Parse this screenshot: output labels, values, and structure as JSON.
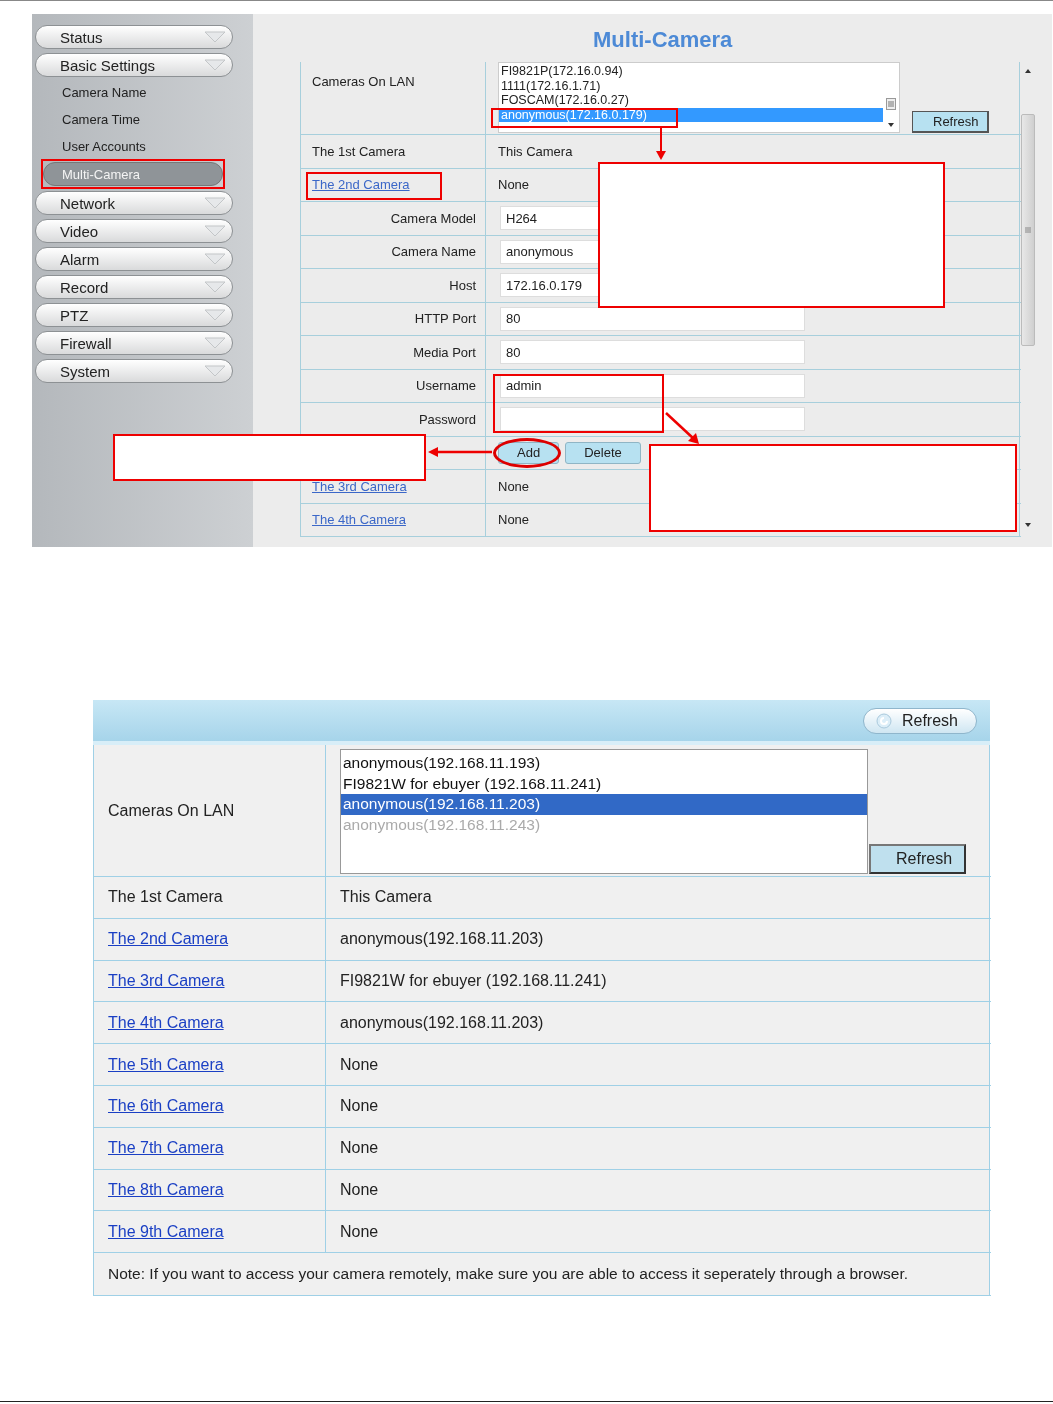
{
  "top_screenshot": {
    "sidebar": {
      "items": [
        {
          "kind": "menu",
          "label": "Status",
          "selected": false
        },
        {
          "kind": "menu",
          "label": "Basic Settings",
          "selected": false
        },
        {
          "kind": "submenu",
          "label": "Camera Name",
          "selected": false
        },
        {
          "kind": "submenu",
          "label": "Camera Time",
          "selected": false
        },
        {
          "kind": "submenu",
          "label": "User Accounts",
          "selected": false
        },
        {
          "kind": "submenu",
          "label": "Multi-Camera",
          "selected": true
        },
        {
          "kind": "menu",
          "label": "Network",
          "selected": false
        },
        {
          "kind": "menu",
          "label": "Video",
          "selected": false
        },
        {
          "kind": "menu",
          "label": "Alarm",
          "selected": false
        },
        {
          "kind": "menu",
          "label": "Record",
          "selected": false
        },
        {
          "kind": "menu",
          "label": "PTZ",
          "selected": false
        },
        {
          "kind": "menu",
          "label": "Firewall",
          "selected": false
        },
        {
          "kind": "menu",
          "label": "System",
          "selected": false
        }
      ]
    },
    "title": "Multi-Camera",
    "cameras_on_lan": {
      "label": "Cameras On LAN",
      "options": [
        {
          "label": "FI9821P(172.16.0.94)",
          "selected": false
        },
        {
          "label": "1111(172.16.1.71)",
          "selected": false
        },
        {
          "label": "FOSCAM(172.16.0.27)",
          "selected": false
        },
        {
          "label": "anonymous(172.16.0.179)",
          "selected": true
        }
      ],
      "button": "Refresh"
    },
    "rows": [
      {
        "kind": "text",
        "label": "The 1st Camera",
        "value": "This Camera"
      },
      {
        "kind": "link",
        "label": "The 2nd Camera",
        "value": "None"
      },
      {
        "kind": "field",
        "label": "Camera Model",
        "value": "H264"
      },
      {
        "kind": "field",
        "label": "Camera Name",
        "value": "anonymous"
      },
      {
        "kind": "field",
        "label": "Host",
        "value": "172.16.0.179"
      },
      {
        "kind": "field",
        "label": "HTTP Port",
        "value": "80"
      },
      {
        "kind": "field",
        "label": "Media Port",
        "value": "80"
      },
      {
        "kind": "field",
        "label": "Username",
        "value": "admin"
      },
      {
        "kind": "field",
        "label": "Password"
      },
      {
        "kind": "buttons",
        "buttons": [
          "Add",
          "Delete"
        ]
      },
      {
        "kind": "link",
        "label": "The 3rd Camera",
        "value": "None"
      },
      {
        "kind": "link",
        "label": "The 4th Camera",
        "value": "None"
      }
    ]
  },
  "bottom_screenshot": {
    "header_button": "Refresh",
    "cameras_on_lan": {
      "label": "Cameras On LAN",
      "options": [
        {
          "label": "anonymous(192.168.11.193)",
          "selected": false,
          "disabled": false
        },
        {
          "label": "FI9821W for ebuyer (192.168.11.241)",
          "selected": false,
          "disabled": false
        },
        {
          "label": "anonymous(192.168.11.203)",
          "selected": true,
          "disabled": false
        },
        {
          "label": "anonymous(192.168.11.243)",
          "selected": false,
          "disabled": true
        }
      ],
      "button": "Refresh"
    },
    "rows": [
      {
        "kind": "text",
        "label": "The 1st Camera",
        "value": "This Camera"
      },
      {
        "kind": "link",
        "label": "The 2nd Camera",
        "value": "anonymous(192.168.11.203)"
      },
      {
        "kind": "link",
        "label": "The 3rd Camera",
        "value": "FI9821W for ebuyer (192.168.11.241)"
      },
      {
        "kind": "link",
        "label": "The 4th Camera",
        "value": "anonymous(192.168.11.203)"
      },
      {
        "kind": "link",
        "label": "The 5th Camera",
        "value": "None"
      },
      {
        "kind": "link",
        "label": "The 6th Camera",
        "value": "None"
      },
      {
        "kind": "link",
        "label": "The 7th Camera",
        "value": "None"
      },
      {
        "kind": "link",
        "label": "The 8th Camera",
        "value": "None"
      },
      {
        "kind": "link",
        "label": "The 9th Camera",
        "value": "None"
      }
    ],
    "note": "Note: If you want to access your camera remotely, make sure you are able to access it seperately through a browser."
  }
}
